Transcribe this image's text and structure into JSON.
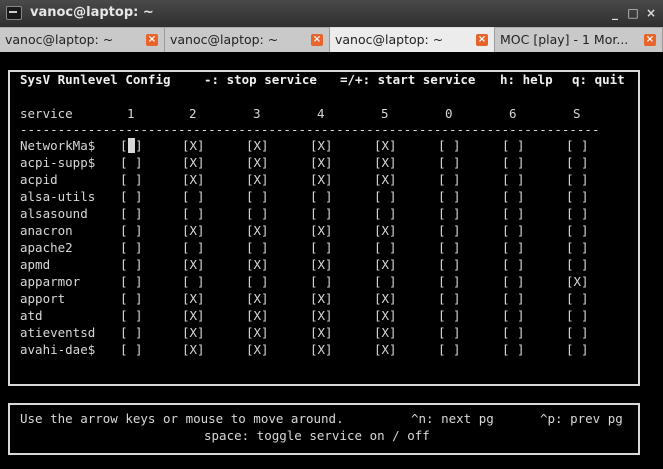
{
  "window": {
    "title": "vanoc@laptop: ~",
    "min_glyph": "_",
    "max_glyph": "□",
    "close_glyph": "×"
  },
  "tabs": [
    {
      "label": "vanoc@laptop: ~",
      "active": false
    },
    {
      "label": "vanoc@laptop: ~",
      "active": false
    },
    {
      "label": "vanoc@laptop: ~",
      "active": true
    },
    {
      "label": "MOC [play] - 1 Mor...",
      "active": false
    }
  ],
  "tab_close_glyph": "×",
  "header": {
    "title": "SysV Runlevel Config",
    "stop": "-: stop service",
    "start": "=/+: start service",
    "help": "h: help",
    "quit": "q: quit"
  },
  "columns": {
    "service_label": "service",
    "runlevels": [
      "1",
      "2",
      "3",
      "4",
      "5",
      "0",
      "6",
      "S"
    ]
  },
  "separator": "-----------------------------------------------------------------------------",
  "services": [
    {
      "name": "NetworkMa$",
      "states": [
        "[ ]",
        "[X]",
        "[X]",
        "[X]",
        "[X]",
        "[ ]",
        "[ ]",
        "[ ]"
      ]
    },
    {
      "name": "acpi-supp$",
      "states": [
        "[ ]",
        "[X]",
        "[X]",
        "[X]",
        "[X]",
        "[ ]",
        "[ ]",
        "[ ]"
      ]
    },
    {
      "name": "acpid",
      "states": [
        "[ ]",
        "[X]",
        "[X]",
        "[X]",
        "[X]",
        "[ ]",
        "[ ]",
        "[ ]"
      ]
    },
    {
      "name": "alsa-utils",
      "states": [
        "[ ]",
        "[ ]",
        "[ ]",
        "[ ]",
        "[ ]",
        "[ ]",
        "[ ]",
        "[ ]"
      ]
    },
    {
      "name": "alsasound",
      "states": [
        "[ ]",
        "[ ]",
        "[ ]",
        "[ ]",
        "[ ]",
        "[ ]",
        "[ ]",
        "[ ]"
      ]
    },
    {
      "name": "anacron",
      "states": [
        "[ ]",
        "[X]",
        "[X]",
        "[X]",
        "[X]",
        "[ ]",
        "[ ]",
        "[ ]"
      ]
    },
    {
      "name": "apache2",
      "states": [
        "[ ]",
        "[ ]",
        "[ ]",
        "[ ]",
        "[ ]",
        "[ ]",
        "[ ]",
        "[ ]"
      ]
    },
    {
      "name": "apmd",
      "states": [
        "[ ]",
        "[X]",
        "[X]",
        "[X]",
        "[X]",
        "[ ]",
        "[ ]",
        "[ ]"
      ]
    },
    {
      "name": "apparmor",
      "states": [
        "[ ]",
        "[ ]",
        "[ ]",
        "[ ]",
        "[ ]",
        "[ ]",
        "[ ]",
        "[X]"
      ]
    },
    {
      "name": "apport",
      "states": [
        "[ ]",
        "[X]",
        "[X]",
        "[X]",
        "[X]",
        "[ ]",
        "[ ]",
        "[ ]"
      ]
    },
    {
      "name": "atd",
      "states": [
        "[ ]",
        "[X]",
        "[X]",
        "[X]",
        "[X]",
        "[ ]",
        "[ ]",
        "[ ]"
      ]
    },
    {
      "name": "atieventsd",
      "states": [
        "[ ]",
        "[X]",
        "[X]",
        "[X]",
        "[X]",
        "[ ]",
        "[ ]",
        "[ ]"
      ]
    },
    {
      "name": "avahi-dae$",
      "states": [
        "[ ]",
        "[X]",
        "[X]",
        "[X]",
        "[X]",
        "[ ]",
        "[ ]",
        "[ ]"
      ]
    }
  ],
  "cursor": {
    "row": 0,
    "col": 0
  },
  "footer": {
    "line1_left": "Use the arrow keys or mouse to move around.",
    "line1_next": "^n: next pg",
    "line1_prev": "^p: prev pg",
    "line2": "space: toggle service on / off"
  },
  "colors": {
    "terminal_bg": "#000000",
    "terminal_fg": "#d8d8d8",
    "tab_close": "#e8642a"
  }
}
